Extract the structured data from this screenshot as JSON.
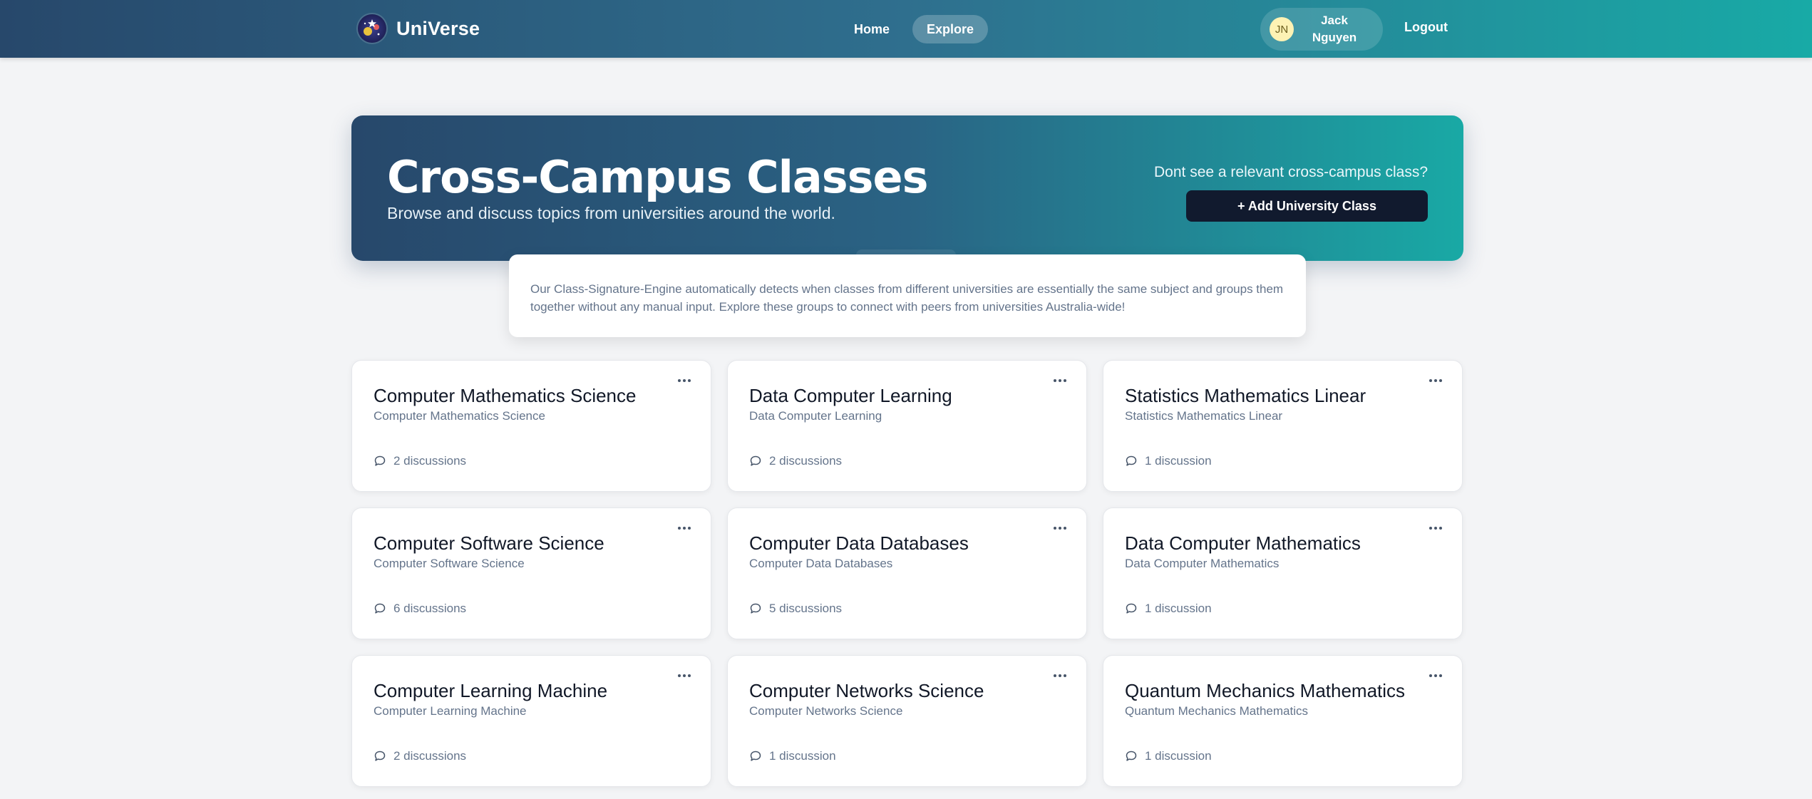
{
  "brand": {
    "name": "UniVerse",
    "logo_icon": "star-planet-icon"
  },
  "nav": {
    "links": [
      {
        "label": "Home",
        "active": false
      },
      {
        "label": "Explore",
        "active": true
      }
    ]
  },
  "user": {
    "initials": "JN",
    "first_name": "Jack",
    "last_name": "Nguyen",
    "logout_label": "Logout"
  },
  "hero": {
    "title": "Cross-Campus Classes",
    "subtitle": "Browse and discuss topics from universities around the world.",
    "cta_text": "Dont see a relevant cross-campus class?",
    "add_button_label": "+ Add University Class"
  },
  "info": {
    "text": "Our Class-Signature-Engine automatically detects when classes from different universities are essentially the same subject and groups them together without any manual input. Explore these groups to connect with peers from universities Australia-wide!"
  },
  "cards": [
    {
      "title": "Computer Mathematics Science",
      "subtitle": "Computer Mathematics Science",
      "discussions": "2 discussions"
    },
    {
      "title": "Data Computer Learning",
      "subtitle": "Data Computer Learning",
      "discussions": "2 discussions"
    },
    {
      "title": "Statistics Mathematics Linear",
      "subtitle": "Statistics Mathematics Linear",
      "discussions": "1 discussion"
    },
    {
      "title": "Computer Software Science",
      "subtitle": "Computer Software Science",
      "discussions": "6 discussions"
    },
    {
      "title": "Computer Data Databases",
      "subtitle": "Computer Data Databases",
      "discussions": "5 discussions"
    },
    {
      "title": "Data Computer Mathematics",
      "subtitle": "Data Computer Mathematics",
      "discussions": "1 discussion"
    },
    {
      "title": "Computer Learning Machine",
      "subtitle": "Computer Learning Machine",
      "discussions": "2 discussions"
    },
    {
      "title": "Computer Networks Science",
      "subtitle": "Computer Networks Science",
      "discussions": "1 discussion"
    },
    {
      "title": "Quantum Mechanics Mathematics",
      "subtitle": "Quantum Mechanics Mathematics",
      "discussions": "1 discussion"
    }
  ],
  "colors": {
    "nav_gradient_start": "#27486b",
    "nav_gradient_end": "#18aaa6",
    "primary_dark": "#111a2e",
    "avatar_bg": "#fdf2b4",
    "page_bg": "#f3f4f6"
  }
}
